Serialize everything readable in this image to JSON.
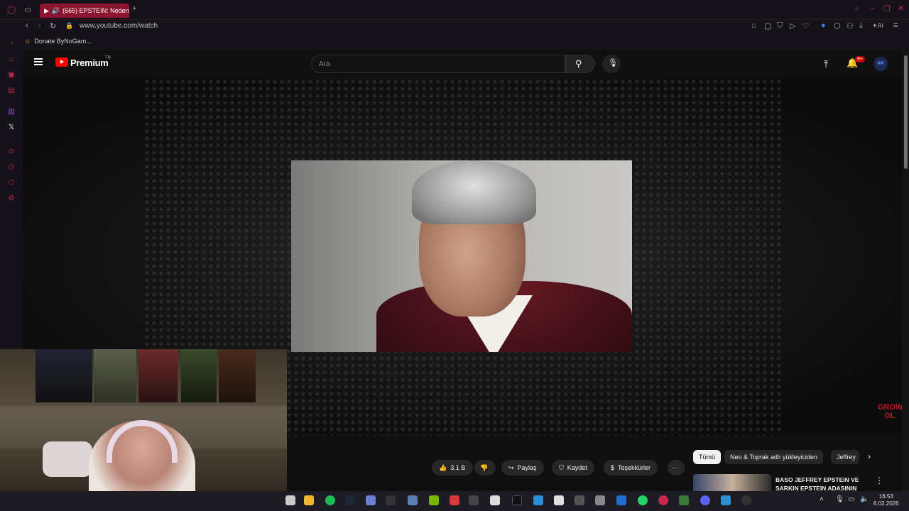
{
  "browser": {
    "tab_title": "(665) EPSTEIN: Neden",
    "url": "www.youtube.com/watch",
    "bookmark": "Donate ByNoGam..."
  },
  "youtube": {
    "brand": "Premium",
    "region": "TR",
    "search_placeholder": "Ara",
    "notification_badge": "9+"
  },
  "actions": {
    "likes": "3,1 B",
    "share": "Paylaş",
    "save": "Kaydet",
    "thanks": "Teşekkürler"
  },
  "recommendations": {
    "chips": [
      "Tümü",
      "Neo & Toprak adlı yükleyiciden",
      "Jeffrey"
    ],
    "first_title": "BASO JEFFREY EPSTEIN VE SARKIN EPSTEIN ADASININ"
  },
  "watermark": {
    "text": "GROW OL"
  },
  "taskbar": {
    "time": "16:53",
    "date": "6.02.2026"
  },
  "colors": {
    "accent": "#8c1631",
    "yt_red": "#ff0000"
  }
}
